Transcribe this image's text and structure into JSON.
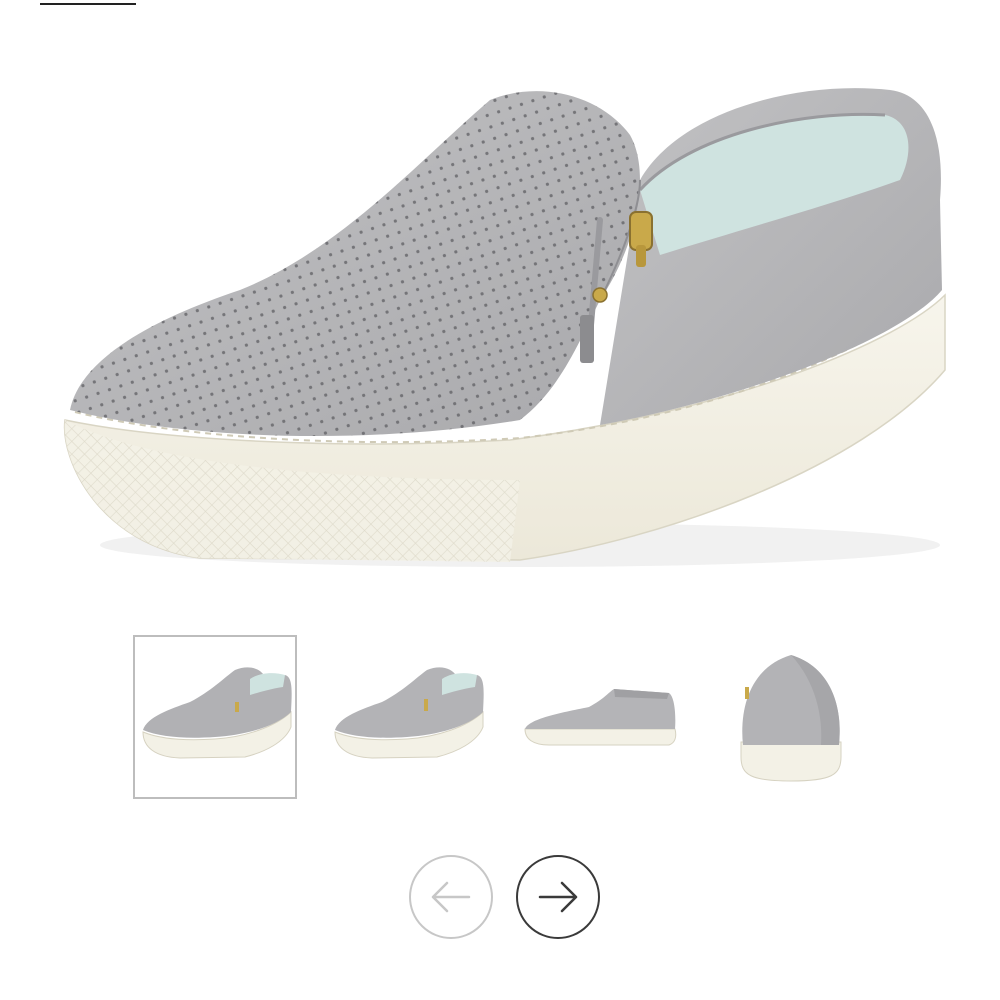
{
  "product_gallery": {
    "main_image": {
      "icon": "gray-perforated-slip-on-sneaker-with-side-zipper"
    },
    "thumbnails": [
      {
        "icon": "shoe-three-quarter-view",
        "selected": true
      },
      {
        "icon": "shoe-three-quarter-view-alt",
        "selected": false
      },
      {
        "icon": "shoe-side-profile-view",
        "selected": false
      },
      {
        "icon": "shoe-heel-back-view",
        "selected": false
      }
    ],
    "navigation": {
      "prev_icon": "arrow-left-icon",
      "next_icon": "arrow-right-icon"
    }
  },
  "colors": {
    "suede": "#b5b5b7",
    "suede_dark": "#a3a3a6",
    "sole": "#f3f1e6",
    "lining": "#cfe3e0",
    "zipper": "#c9a94a",
    "selected_border": "#bdbdbd",
    "nav_disabled": "#c7c7c7",
    "nav_active": "#3a3a3a"
  }
}
